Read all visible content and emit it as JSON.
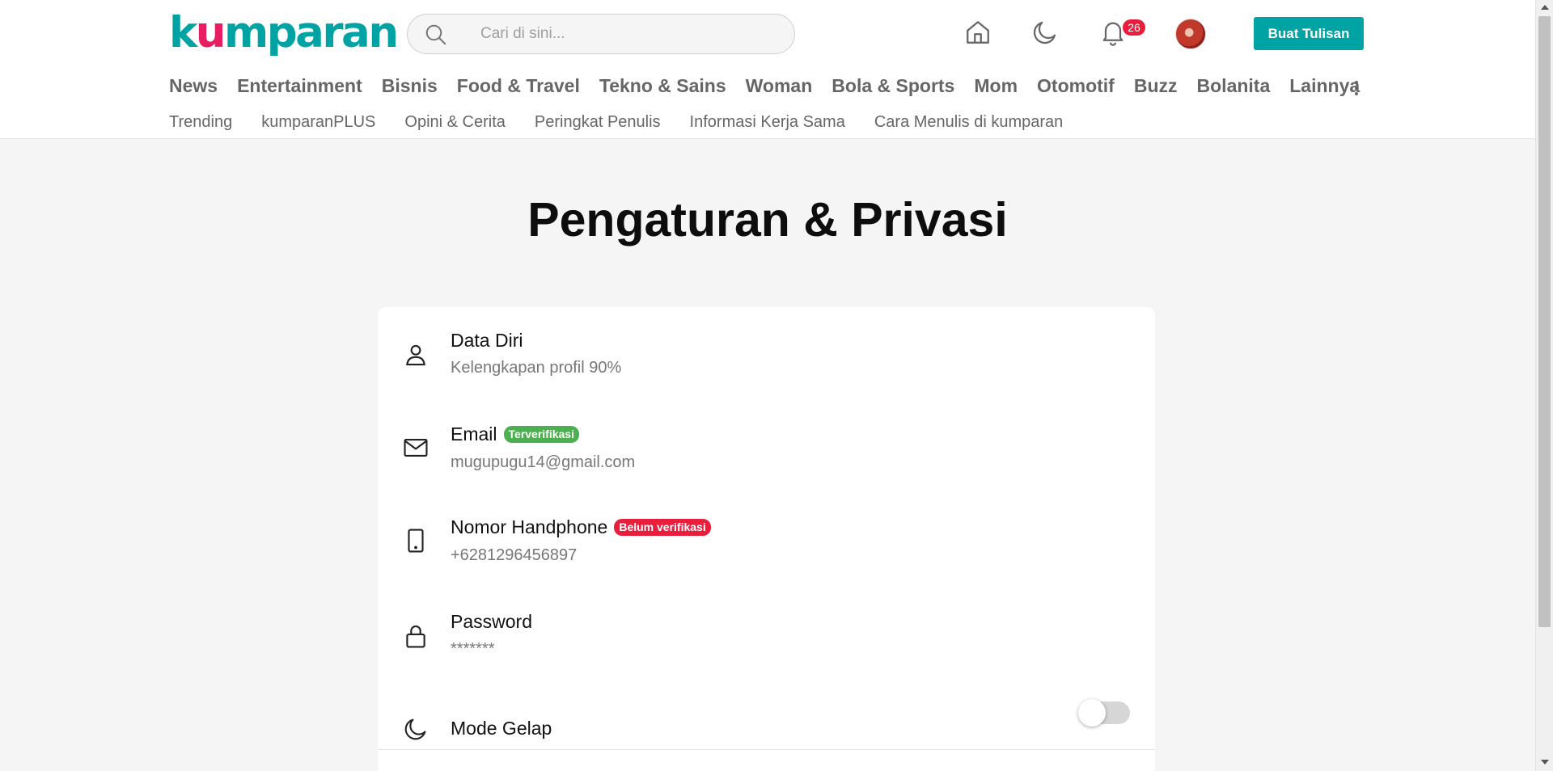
{
  "brand": {
    "logo_prefix": "k",
    "logo_u": "u",
    "logo_suffix": "mparan",
    "accent": "#00a3a3",
    "alert": "#e81e3c"
  },
  "header": {
    "search_placeholder": "Cari di sini...",
    "notification_count": "26",
    "write_button": "Buat Tulisan",
    "icons": [
      "home-icon",
      "moon-icon",
      "bell-icon",
      "avatar"
    ]
  },
  "nav": {
    "items": [
      "News",
      "Entertainment",
      "Bisnis",
      "Food & Travel",
      "Tekno & Sains",
      "Woman",
      "Bola & Sports",
      "Mom",
      "Otomotif",
      "Buzz",
      "Bolanita",
      "Lainnya"
    ],
    "sub_items": [
      "Trending",
      "kumparanPLUS",
      "Opini & Cerita",
      "Peringkat Penulis",
      "Informasi Kerja Sama",
      "Cara Menulis di kumparan"
    ]
  },
  "page": {
    "title": "Pengaturan & Privasi"
  },
  "settings": {
    "data_diri": {
      "title": "Data Diri",
      "subtitle": "Kelengkapan profil 90%"
    },
    "email": {
      "title": "Email",
      "badge": "Terverifikasi",
      "value": "mugupugu14@gmail.com"
    },
    "phone": {
      "title": "Nomor Handphone",
      "badge": "Belum verifikasi",
      "value": "+6281296456897"
    },
    "password": {
      "title": "Password",
      "value": "*******"
    },
    "dark_mode": {
      "title": "Mode Gelap",
      "enabled": false
    }
  }
}
